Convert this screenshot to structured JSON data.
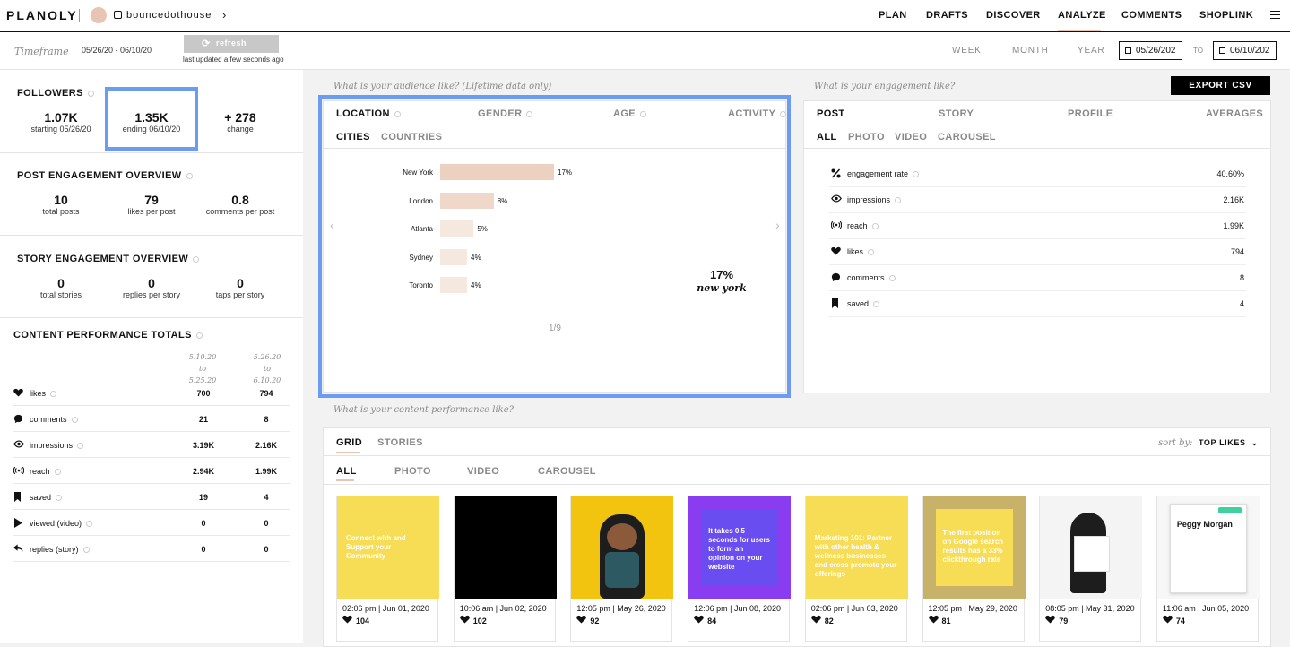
{
  "app": {
    "logo": "PLANOLY",
    "account": "bouncedothouse"
  },
  "nav": {
    "items": [
      "PLAN",
      "DRAFTS",
      "DISCOVER",
      "ANALYZE",
      "COMMENTS",
      "SHOPLINK"
    ],
    "active": "ANALYZE"
  },
  "timeframe": {
    "label": "Timeframe",
    "range": "05/26/20 - 06/10/20",
    "refresh": "refresh",
    "updated": "last updated a few seconds ago",
    "week": "WEEK",
    "month": "MONTH",
    "year": "YEAR",
    "from": "05/26/202",
    "to_label": "TO",
    "to": "06/10/202"
  },
  "followers": {
    "title": "FOLLOWERS",
    "start_val": "1.07K",
    "start_label": "starting 05/26/20",
    "end_val": "1.35K",
    "end_label": "ending 06/10/20",
    "change_val": "+ 278",
    "change_label": "change"
  },
  "post_eng": {
    "title": "POST ENGAGEMENT OVERVIEW",
    "stats": [
      {
        "v": "10",
        "l": "total posts"
      },
      {
        "v": "79",
        "l": "likes per post"
      },
      {
        "v": "0.8",
        "l": "comments per post"
      }
    ]
  },
  "story_eng": {
    "title": "STORY ENGAGEMENT OVERVIEW",
    "stats": [
      {
        "v": "0",
        "l": "total stories"
      },
      {
        "v": "0",
        "l": "replies per story"
      },
      {
        "v": "0",
        "l": "taps per story"
      }
    ]
  },
  "content_totals": {
    "title": "CONTENT PERFORMANCE TOTALS",
    "col1": "5.10.20 to 5.25.20",
    "col2": "5.26.20 to 6.10.20",
    "rows": [
      {
        "icon": "heart-icon",
        "label": "likes",
        "a": "700",
        "b": "794"
      },
      {
        "icon": "comment-icon",
        "label": "comments",
        "a": "21",
        "b": "8"
      },
      {
        "icon": "eye-icon",
        "label": "impressions",
        "a": "3.19K",
        "b": "2.16K"
      },
      {
        "icon": "reach-icon",
        "label": "reach",
        "a": "2.94K",
        "b": "1.99K"
      },
      {
        "icon": "bookmark-icon",
        "label": "saved",
        "a": "19",
        "b": "4"
      },
      {
        "icon": "play-icon",
        "label": "viewed (video)",
        "a": "0",
        "b": "0"
      },
      {
        "icon": "reply-icon",
        "label": "replies (story)",
        "a": "0",
        "b": "0"
      }
    ]
  },
  "audience": {
    "question": "What is your audience like? (Lifetime data only)",
    "tabs": [
      "LOCATION",
      "GENDER",
      "AGE",
      "ACTIVITY"
    ],
    "subtabs": [
      "CITIES",
      "COUNTRIES"
    ],
    "pager": "1/9",
    "highlight_value": "17%",
    "highlight_city": "new york"
  },
  "chart_data": {
    "type": "bar",
    "orientation": "horizontal",
    "categories": [
      "New York",
      "London",
      "Atlanta",
      "Sydney",
      "Toronto"
    ],
    "values": [
      17,
      8,
      5,
      4,
      4
    ],
    "unit": "%",
    "labels": [
      "17%",
      "8%",
      "5%",
      "4%",
      "4%"
    ]
  },
  "engagement": {
    "question": "What is your engagement like?",
    "export": "EXPORT CSV",
    "tabs": [
      "POST",
      "STORY",
      "PROFILE",
      "AVERAGES"
    ],
    "subtabs": [
      "ALL",
      "PHOTO",
      "VIDEO",
      "CAROUSEL"
    ],
    "rows": [
      {
        "icon": "percent-icon",
        "label": "engagement rate",
        "value": "40.60%"
      },
      {
        "icon": "eye-icon",
        "label": "impressions",
        "value": "2.16K"
      },
      {
        "icon": "reach-icon",
        "label": "reach",
        "value": "1.99K"
      },
      {
        "icon": "heart-icon",
        "label": "likes",
        "value": "794"
      },
      {
        "icon": "comment-icon",
        "label": "comments",
        "value": "8"
      },
      {
        "icon": "bookmark-icon",
        "label": "saved",
        "value": "4"
      }
    ]
  },
  "content": {
    "question": "What is your content performance like?",
    "tabs": [
      "GRID",
      "STORIES"
    ],
    "sort_label": "sort by:",
    "sort_value": "TOP LIKES",
    "subtabs": [
      "ALL",
      "PHOTO",
      "VIDEO",
      "CAROUSEL"
    ],
    "posts": [
      {
        "date": "02:06 pm | Jun 01, 2020",
        "likes": "104",
        "bg": "#f6dd55",
        "text": "Connect with and Support your Community"
      },
      {
        "date": "10:06 am | Jun 02, 2020",
        "likes": "102",
        "bg": "#000000",
        "text": ""
      },
      {
        "date": "12:05 pm | May 26, 2020",
        "likes": "92",
        "bg": "#f2c40f",
        "text": ""
      },
      {
        "date": "12:06 pm | Jun 08, 2020",
        "likes": "84",
        "bg": "#8a3cf0",
        "text": "It takes 0.5 seconds for users to form an opinion on your website"
      },
      {
        "date": "02:06 pm | Jun 03, 2020",
        "likes": "82",
        "bg": "#f6dd55",
        "text": "Marketing 101: Partner with other health & wellness businesses and cross promote your offerings"
      },
      {
        "date": "12:05 pm | May 29, 2020",
        "likes": "81",
        "bg": "#c8b26a",
        "text": "The first position on Google search results has a 33% clickthrough rate"
      },
      {
        "date": "08:05 pm | May 31, 2020",
        "likes": "79",
        "bg": "#f4f4f4",
        "text": ""
      },
      {
        "date": "11:06 am | Jun 05, 2020",
        "likes": "74",
        "bg": "#f7f7f7",
        "text": "Peggy Morgan"
      }
    ]
  }
}
